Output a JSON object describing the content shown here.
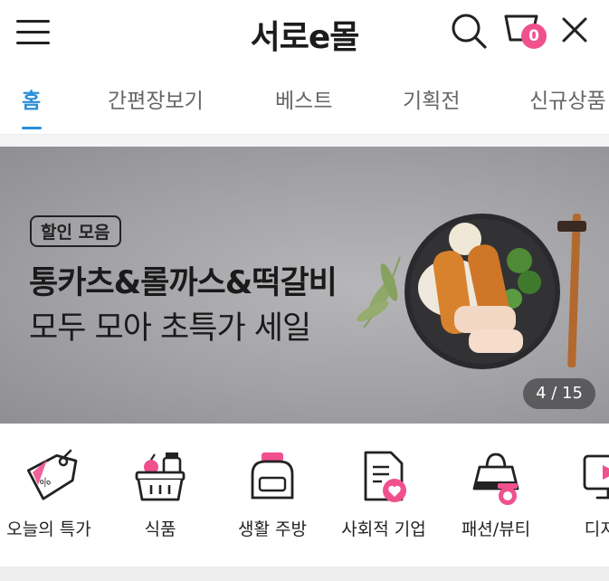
{
  "header": {
    "logo": "서로e몰",
    "cart_count": "0",
    "icons": [
      "menu-icon",
      "search-icon",
      "cart-icon",
      "close-icon"
    ]
  },
  "tabs": [
    {
      "label": "홈",
      "active": true
    },
    {
      "label": "간편장보기",
      "active": false
    },
    {
      "label": "베스트",
      "active": false
    },
    {
      "label": "기획전",
      "active": false
    },
    {
      "label": "신규상품",
      "active": false
    }
  ],
  "banner": {
    "badge": "할인 모음",
    "line1": "통카츠&롤까스&떡갈비",
    "line2": "모두 모아 초특가 세일",
    "counter": "4 / 15"
  },
  "categories": [
    {
      "label": "오늘의 특가",
      "icon": "price-tag-icon"
    },
    {
      "label": "식품",
      "icon": "grocery-basket-icon"
    },
    {
      "label": "생활 주방",
      "icon": "toaster-icon"
    },
    {
      "label": "사회적 기업",
      "icon": "document-heart-icon"
    },
    {
      "label": "패션/뷰티",
      "icon": "handbag-icon"
    },
    {
      "label": "디지털",
      "icon": "monitor-play-icon"
    }
  ],
  "colors": {
    "accent": "#f0508e",
    "tab_active": "#2c8fd8"
  }
}
